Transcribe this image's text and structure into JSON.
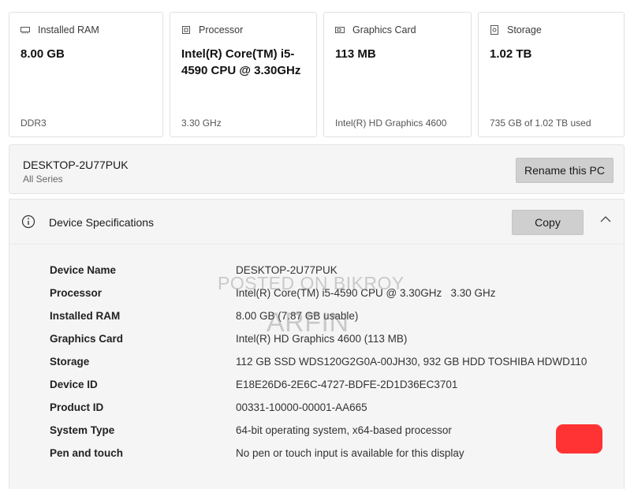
{
  "cards": [
    {
      "title": "Installed RAM",
      "value": "8.00 GB",
      "foot": "DDR3",
      "icon": "ram-icon"
    },
    {
      "title": "Processor",
      "value": "Intel(R) Core(TM) i5-4590 CPU @ 3.30GHz",
      "foot": "3.30 GHz",
      "icon": "cpu-icon"
    },
    {
      "title": "Graphics Card",
      "value": "113 MB",
      "foot": "Intel(R) HD Graphics 4600",
      "icon": "gpu-icon"
    },
    {
      "title": "Storage",
      "value": "1.02 TB",
      "foot": "735 GB of 1.02 TB used",
      "icon": "storage-icon"
    }
  ],
  "pc": {
    "name": "DESKTOP-2U77PUK",
    "series": "All Series",
    "rename_label": "Rename this PC"
  },
  "specs": {
    "title": "Device Specifications",
    "copy_label": "Copy",
    "rows": [
      {
        "key": "Device Name",
        "value": "DESKTOP-2U77PUK"
      },
      {
        "key": "Processor",
        "value": "Intel(R) Core(TM) i5-4590 CPU @ 3.30GHz   3.30 GHz"
      },
      {
        "key": "Installed RAM",
        "value": "8.00 GB (7.87 GB usable)"
      },
      {
        "key": "Graphics Card",
        "value": "Intel(R) HD Graphics 4600 (113 MB)"
      },
      {
        "key": "Storage",
        "value": "112 GB SSD WDS120G2G0A-00JH30, 932 GB HDD TOSHIBA HDWD110"
      },
      {
        "key": "Device ID",
        "value": "E18E26D6-2E6C-4727-BDFE-2D1D36EC3701"
      },
      {
        "key": "Product ID",
        "value": "00331-10000-00001-AA665"
      },
      {
        "key": "System Type",
        "value": "64-bit operating system, x64-based processor"
      },
      {
        "key": "Pen and touch",
        "value": "No pen or touch input is available for this display"
      }
    ]
  },
  "watermark": {
    "line1": "POSTED ON BIKROY",
    "line2": "ARFIN"
  },
  "colors": {
    "card_bg": "#ffffff",
    "panel_bg": "#f5f5f5",
    "button_bg": "#cfcfcf",
    "mark": "#ff3333"
  }
}
